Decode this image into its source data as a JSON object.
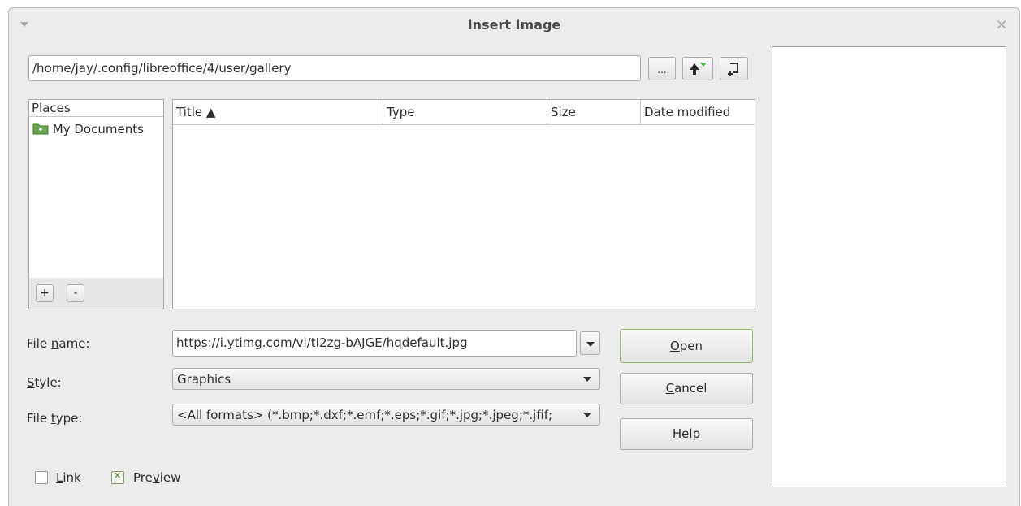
{
  "window": {
    "title": "Insert Image"
  },
  "path_bar": {
    "value": "/home/jay/.config/libreoffice/4/user/gallery",
    "browse_label": "..."
  },
  "places": {
    "header": "Places",
    "items": [
      {
        "label": "My Documents",
        "icon": "folder-icon"
      }
    ],
    "add_label": "+",
    "remove_label": "-"
  },
  "file_list": {
    "columns": [
      "Title ▲",
      "Type",
      "Size",
      "Date modified"
    ],
    "rows": []
  },
  "form": {
    "file_name_label_pre": "File ",
    "file_name_label_key": "n",
    "file_name_label_post": "ame:",
    "file_name_value": "https://i.ytimg.com/vi/tI2zg-bAJGE/hqdefault.jpg",
    "style_label_key": "S",
    "style_label_post": "tyle:",
    "style_value": "Graphics",
    "file_type_label_pre": "File ",
    "file_type_label_key": "t",
    "file_type_label_post": "ype:",
    "file_type_value": "<All formats> (*.bmp;*.dxf;*.emf;*.eps;*.gif;*.jpg;*.jpeg;*.jfif;"
  },
  "buttons": {
    "open_key": "O",
    "open_rest": "pen",
    "cancel_key": "C",
    "cancel_rest": "ancel",
    "help_key": "H",
    "help_rest": "elp"
  },
  "options": {
    "link_key": "L",
    "link_rest": "ink",
    "link_checked": false,
    "preview_pre": "Pre",
    "preview_key": "v",
    "preview_post": "iew",
    "preview_checked": true
  },
  "colors": {
    "default_button_border": "#8fbe6d",
    "folder_icon": "#6aa84f"
  }
}
